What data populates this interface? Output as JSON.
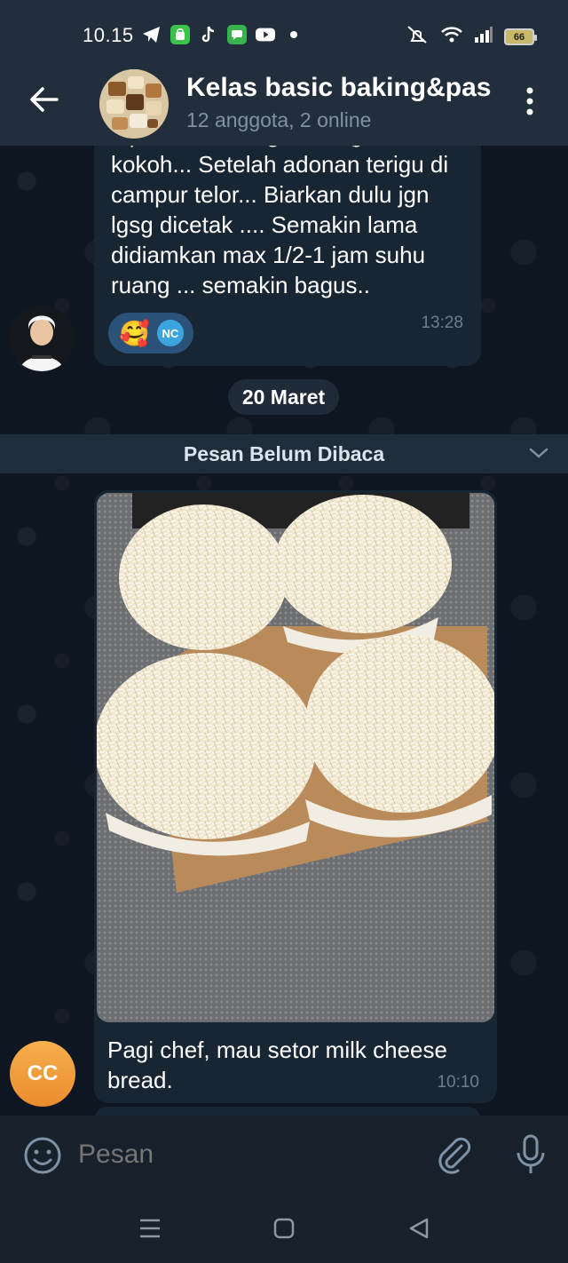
{
  "status_bar": {
    "time": "10.15",
    "battery": "66",
    "icons": [
      "telegram-icon",
      "cart-icon",
      "tiktok-icon",
      "messages-icon",
      "youtube-icon",
      "dot-icon",
      "mute-icon",
      "wifi-icon",
      "signal-icon",
      "battery-icon"
    ]
  },
  "header": {
    "title": "Kelas basic baking&pas",
    "subtitle": "12 anggota, 2 online"
  },
  "messages": [
    {
      "text": "Tipe semakin ngembang dan kokoh... Setelah adonan terigu di campur telor... Biarkan dulu jgn lgsg dicetak .... Semakin lama didiamkan max 1/2-1 jam suhu ruang  ... semakin bagus..",
      "time": "13:28",
      "reaction_emoji": "🥰",
      "reaction_user": "NC"
    },
    {
      "text": "Pagi chef, mau setor milk cheese bread.",
      "time": "10:10",
      "sender_initials": "CC"
    }
  ],
  "date_separator": "20 Maret",
  "unread_label": "Pesan Belum Dibaca",
  "input": {
    "placeholder": "Pesan"
  },
  "colors": {
    "header_bg": "#232e3c",
    "chat_bg": "#0e1621",
    "bubble_bg": "#182533",
    "accent": "#3ca5df",
    "muted_text": "#7f91a4"
  }
}
